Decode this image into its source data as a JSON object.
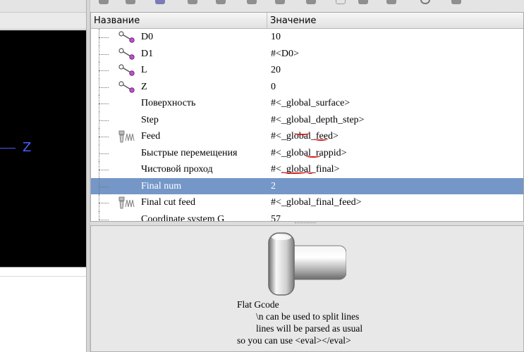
{
  "canvas": {
    "axis_label": "Z"
  },
  "tree": {
    "columns": [
      "Название",
      "Значение"
    ],
    "rows": [
      {
        "label": "D0",
        "value": "10",
        "icon": "dimension-icon"
      },
      {
        "label": "D1",
        "value": "#<D0>",
        "icon": "dimension-icon"
      },
      {
        "label": "L",
        "value": "20",
        "icon": "dimension-icon"
      },
      {
        "label": "Z",
        "value": "0",
        "icon": "dimension-icon"
      },
      {
        "label": "Поверхность",
        "value": "#<_global_surface>",
        "icon": ""
      },
      {
        "label": "Step",
        "value": "#<_global_depth_step>",
        "icon": ""
      },
      {
        "label": "Feed",
        "value": "#<_global_feed>",
        "icon": "feed-icon"
      },
      {
        "label": "Быстрые перемещения",
        "value": "#<_global_rappid>",
        "icon": ""
      },
      {
        "label": "Чистовой проход",
        "value": "#<_global_final>",
        "icon": ""
      },
      {
        "label": "Final num",
        "value": "2",
        "icon": "",
        "selected": true
      },
      {
        "label": "Final cut feed",
        "value": "#<_global_final_feed>",
        "icon": "feed-icon"
      },
      {
        "label": "Coordinate system G",
        "value": "57",
        "icon": ""
      }
    ]
  },
  "preview": {
    "tool_icon": "flat-cutter-icon",
    "description": "Flat Gcode\n        \\n can be used to split lines\n        lines will be parsed as usual\nso you can use <eval></eval>"
  },
  "colors": {
    "selection": "#7497c8",
    "annotation": "#d21c1c",
    "axis": "#4a5cff"
  }
}
